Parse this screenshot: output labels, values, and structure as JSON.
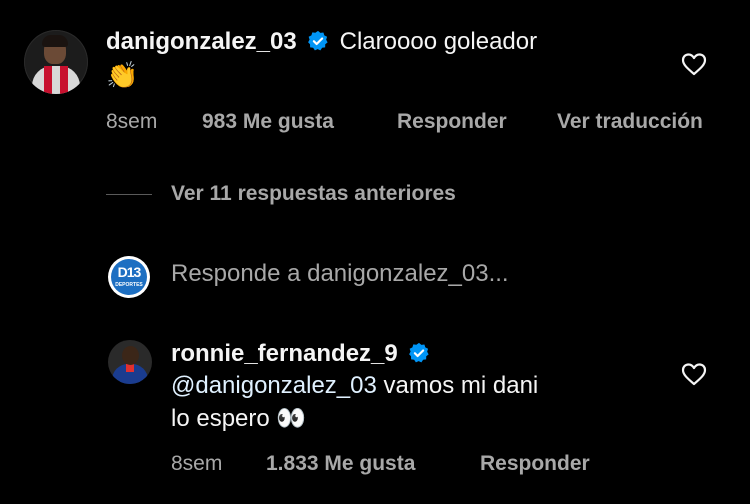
{
  "comment1": {
    "username": "danigonzalez_03",
    "text": "Claroooo goleador",
    "emoji": "👏",
    "time": "8sem",
    "likes": "983 Me gusta",
    "reply": "Responder",
    "translate": "Ver traducción"
  },
  "thread": {
    "view_previous": "Ver 11 respuestas anteriores",
    "reply_prompt": "Responde a danigonzalez_03...",
    "account_logo": "D13",
    "account_logo_sub": "DEPORTES"
  },
  "comment2": {
    "username": "ronnie_fernandez_9",
    "mention": "@danigonzalez_03",
    "text_line1": " vamos mi dani",
    "text_line2": "lo espero 👀",
    "time": "8sem",
    "likes": "1.833 Me gusta",
    "reply": "Responder"
  },
  "icons": {
    "verified": "verified-badge-icon",
    "like": "heart-icon"
  },
  "colors": {
    "background": "#000000",
    "verified": "#0095f6",
    "muted": "#a8a8a8"
  }
}
